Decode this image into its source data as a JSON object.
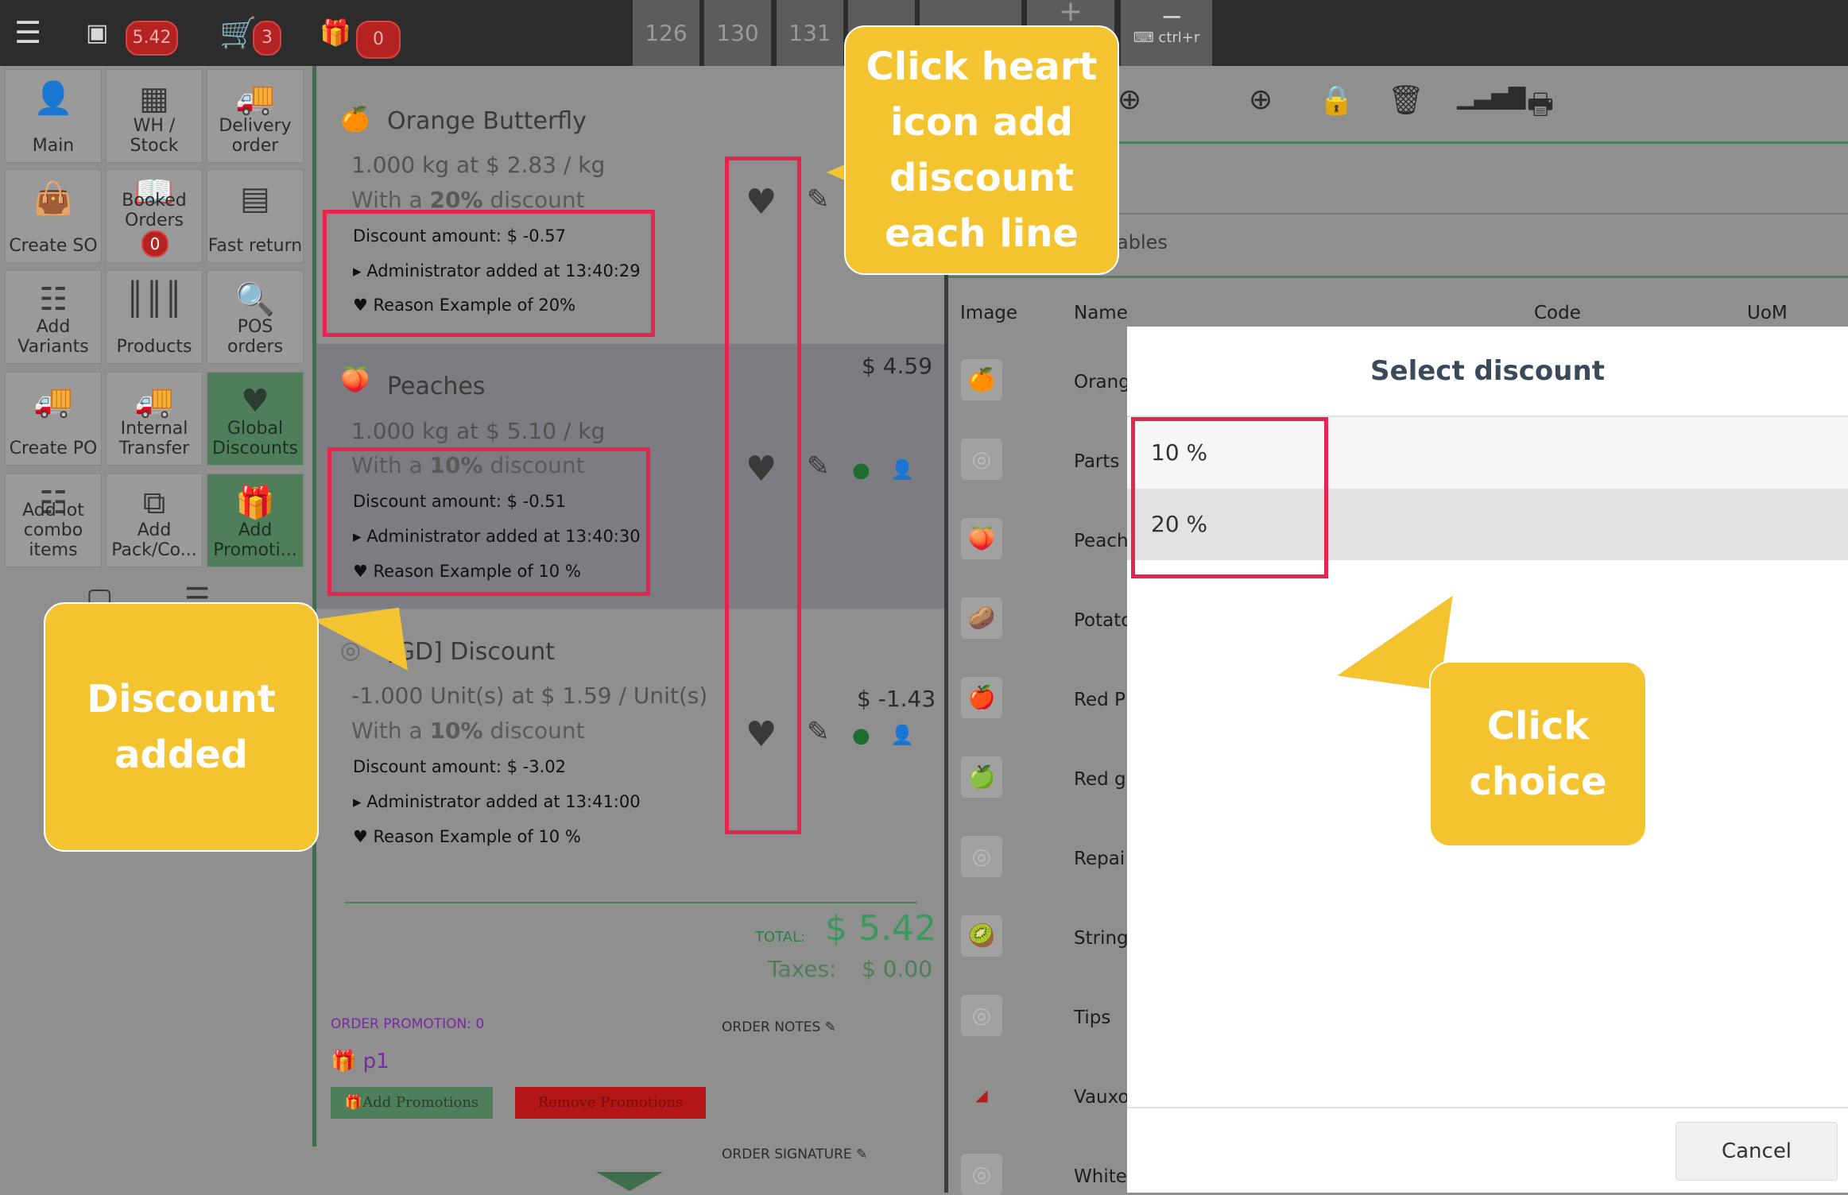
{
  "topbar": {
    "menu_icon": "list-icon",
    "cash_icon": "money-icon",
    "cash_badge": "5.42",
    "cart_icon": "cart-icon",
    "cart_badge": "3",
    "gift_icon": "gift-icon",
    "gift_badge": "0",
    "seats": [
      "126",
      "130",
      "131"
    ],
    "shortcut_label": "ctrl+r"
  },
  "left_menu": {
    "items": [
      {
        "label": "Main",
        "icon": "user-icon"
      },
      {
        "label": "WH / Stock",
        "icon": "grid-icon"
      },
      {
        "label": "Delivery order",
        "icon": "truck-icon"
      },
      {
        "label": "Create SO",
        "icon": "shopping-bag-icon"
      },
      {
        "label": "Booked Orders",
        "icon": "book-icon",
        "badge": "0"
      },
      {
        "label": "Fast return",
        "icon": "calculator-icon"
      },
      {
        "label": "Add Variants",
        "icon": "sliders-icon"
      },
      {
        "label": "Products",
        "icon": "barcode-icon"
      },
      {
        "label": "POS orders",
        "icon": "search-icon"
      },
      {
        "label": "Create PO",
        "icon": "truck-icon"
      },
      {
        "label": "Internal Transfer",
        "icon": "truck-icon"
      },
      {
        "label": "Global Discounts",
        "icon": "heart-icon"
      },
      {
        "label": "Add lot combo items",
        "icon": "sliders-icon"
      },
      {
        "label": "Add Pack/Co...",
        "icon": "cubes-icon"
      },
      {
        "label": "Add Promoti...",
        "icon": "gift-icon"
      }
    ]
  },
  "order": {
    "lines": [
      {
        "name": "Orange Butterfly",
        "qty_line": "1.000 kg at $ 2.83 / kg",
        "discount_prefix": "With a ",
        "discount_pct": "20%",
        "discount_suffix": " discount",
        "discount_amount": "Discount amount: $ -0.57",
        "added_by": "Administrator added at 13:40:29",
        "reason": "Reason Example of 20%",
        "price": ""
      },
      {
        "name": "Peaches",
        "qty_line": "1.000 kg at $ 5.10 / kg",
        "discount_prefix": "With a ",
        "discount_pct": "10%",
        "discount_suffix": " discount",
        "discount_amount": "Discount amount: $ -0.51",
        "added_by": "Administrator added at 13:40:30",
        "reason": "Reason Example of 10 %",
        "price": "$ 4.59"
      },
      {
        "name": "[GD] Discount",
        "qty_line": "-1.000 Unit(s) at $ 1.59 / Unit(s)",
        "discount_prefix": "With a ",
        "discount_pct": "10%",
        "discount_suffix": " discount",
        "discount_amount": "Discount amount: $ -3.02",
        "added_by": "Administrator added at 13:41:00",
        "reason": "Reason Example of 10 %",
        "price": "$ -1.43"
      }
    ],
    "total_label": "TOTAL:",
    "total_value": "$ 5.42",
    "taxes_label": "Taxes:",
    "taxes_value": "$ 0.00",
    "promotion_label": "ORDER PROMOTION: 0",
    "promo_item": "p1",
    "notes_label": "ORDER NOTES",
    "signature_label": "ORDER SIGNATURE",
    "add_promotions_button": "Add Promotions",
    "remove_promotions_button": "Remove Promotions"
  },
  "right": {
    "search_partial": "ables",
    "columns": [
      "Image",
      "Name",
      "Code",
      "UoM"
    ],
    "rows": [
      "Orang",
      "Parts",
      "Peach",
      "Potato",
      "Red P",
      "Red g",
      "Repai",
      "String",
      "Tips",
      "Vauxo",
      "White"
    ],
    "tools": [
      "plus-circle-icon",
      "lock-icon",
      "trash-icon",
      "signal-icon",
      "printer-icon"
    ]
  },
  "modal": {
    "title": "Select discount",
    "options": [
      "10 %",
      "20 %"
    ],
    "cancel_label": "Cancel"
  },
  "callouts": {
    "heart": "Click heart icon add discount each line",
    "added": "Discount added",
    "choice": "Click choice"
  }
}
